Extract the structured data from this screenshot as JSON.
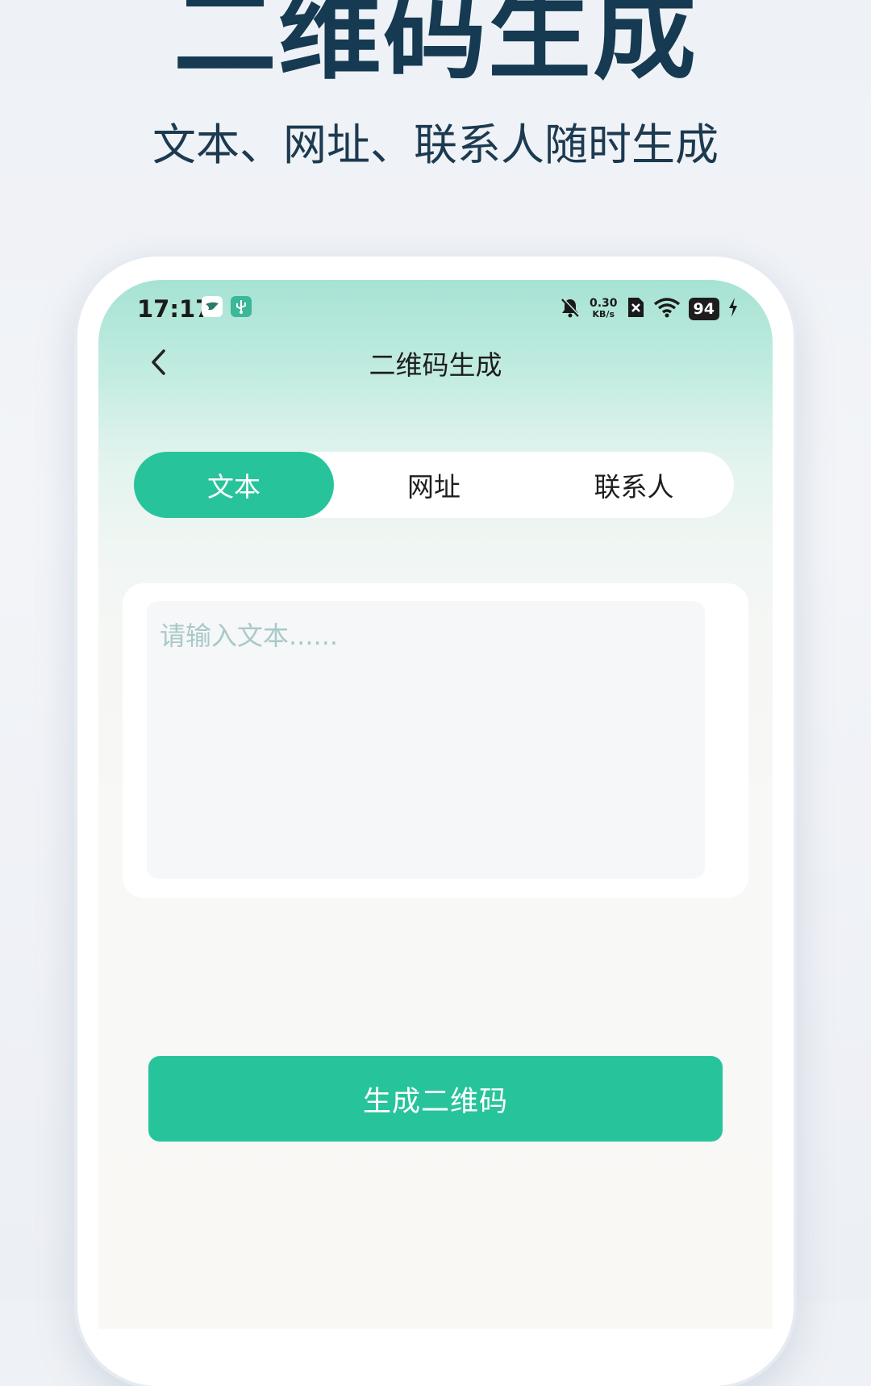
{
  "promo": {
    "title": "二维码生成",
    "subtitle": "文本、网址、联系人随时生成"
  },
  "status_bar": {
    "time": "17:17",
    "net_speed_value": "0.30",
    "net_speed_unit": "KB/s",
    "battery": "94",
    "icons": [
      "bird-app-icon",
      "usb-icon",
      "mute-bell-icon",
      "no-sim-icon",
      "wifi-icon",
      "charging-icon"
    ]
  },
  "nav": {
    "back_icon": "chevron-left-icon",
    "title": "二维码生成"
  },
  "tabs": [
    {
      "label": "文本",
      "active": true
    },
    {
      "label": "网址",
      "active": false
    },
    {
      "label": "联系人",
      "active": false
    }
  ],
  "input": {
    "value": "",
    "placeholder": "请输入文本......"
  },
  "generate_button": {
    "label": "生成二维码"
  },
  "colors": {
    "accent": "#27c49b",
    "title_dark": "#153a52",
    "header_gradient_top": "#a6e3d4",
    "placeholder": "#a9c9c8"
  }
}
